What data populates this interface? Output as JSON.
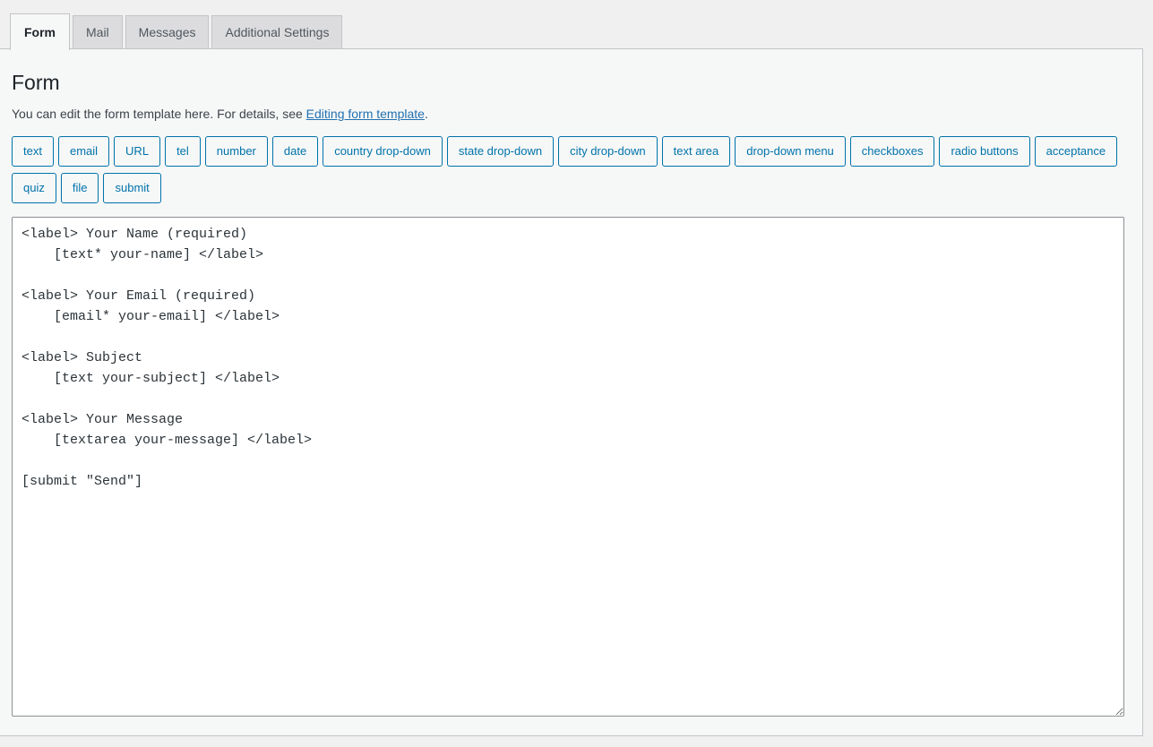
{
  "tabs": [
    {
      "label": "Form",
      "active": true
    },
    {
      "label": "Mail",
      "active": false
    },
    {
      "label": "Messages",
      "active": false
    },
    {
      "label": "Additional Settings",
      "active": false
    }
  ],
  "main": {
    "title": "Form",
    "description_before": "You can edit the form template here. For details, see ",
    "description_link": "Editing form template",
    "description_after": "."
  },
  "tag_buttons": [
    {
      "label": "text"
    },
    {
      "label": "email"
    },
    {
      "label": "URL"
    },
    {
      "label": "tel"
    },
    {
      "label": "number"
    },
    {
      "label": "date"
    },
    {
      "label": "country drop-down"
    },
    {
      "label": "state drop-down"
    },
    {
      "label": "city drop-down"
    },
    {
      "label": "text area"
    },
    {
      "label": "drop-down menu"
    },
    {
      "label": "checkboxes"
    },
    {
      "label": "radio buttons"
    },
    {
      "label": "acceptance"
    },
    {
      "label": "quiz"
    },
    {
      "label": "file"
    },
    {
      "label": "submit"
    }
  ],
  "editor": {
    "value": "<label> Your Name (required)\n    [text* your-name] </label>\n\n<label> Your Email (required)\n    [email* your-email] </label>\n\n<label> Subject\n    [text your-subject] </label>\n\n<label> Your Message\n    [textarea your-message] </label>\n\n[submit \"Send\"]\n",
    "placeholder": ""
  },
  "colors": {
    "page_background": "#f0f0f1",
    "panel_background": "#f6f7f7",
    "panel_border": "#c3c4c7",
    "tab_inactive_background": "#dcdcde",
    "tab_active_background": "#f6f7f7",
    "link": "#2271b1",
    "tag_button_accent": "#0073aa",
    "editor_border": "#8c8f94",
    "editor_background": "#ffffff",
    "text": "#3c434a"
  }
}
